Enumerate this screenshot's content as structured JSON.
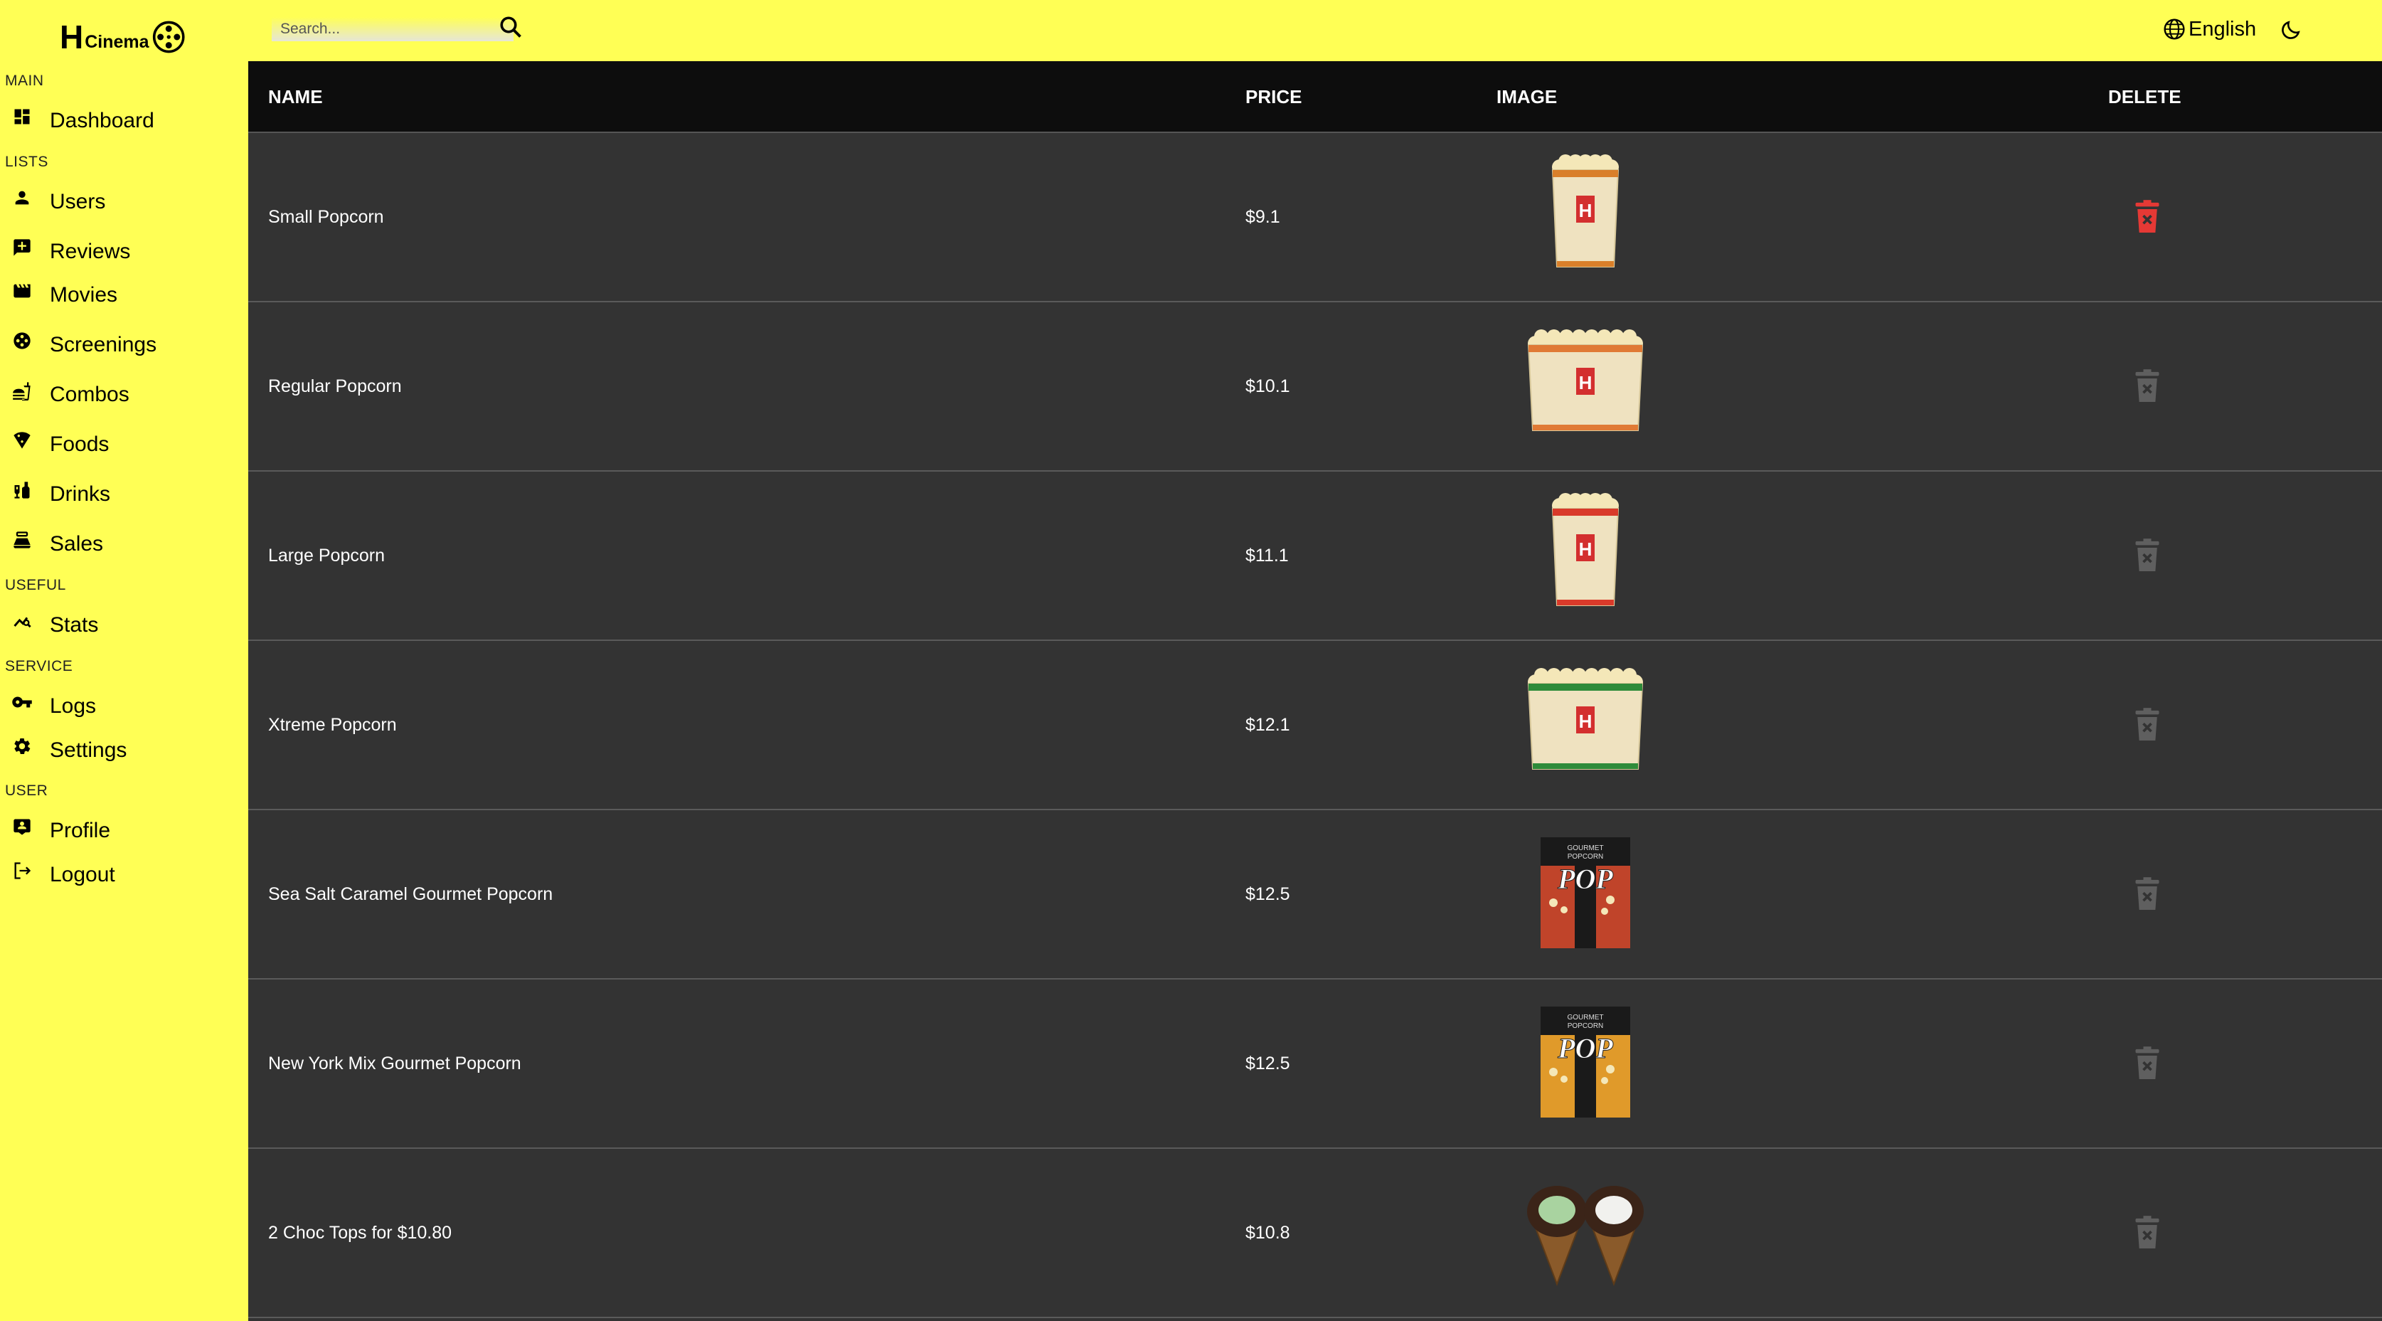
{
  "app": {
    "logo_mark": "H",
    "logo_text": "Cinema"
  },
  "sidebar": {
    "sections": {
      "main": "MAIN",
      "lists": "LISTS",
      "useful": "USEFUL",
      "service": "SERVICE",
      "user": "USER"
    },
    "items": {
      "dashboard": "Dashboard",
      "users": "Users",
      "reviews": "Reviews",
      "movies": "Movies",
      "screenings": "Screenings",
      "combos": "Combos",
      "foods": "Foods",
      "drinks": "Drinks",
      "sales": "Sales",
      "stats": "Stats",
      "logs": "Logs",
      "settings": "Settings",
      "profile": "Profile",
      "logout": "Logout"
    }
  },
  "topbar": {
    "search_placeholder": "Search...",
    "language": "English"
  },
  "table": {
    "headers": {
      "name": "NAME",
      "price": "PRICE",
      "image": "IMAGE",
      "delete": "DELETE"
    },
    "rows": [
      {
        "name": "Small Popcorn",
        "price": "$9.1",
        "image": "popcorn-small",
        "delete_active": true
      },
      {
        "name": "Regular Popcorn",
        "price": "$10.1",
        "image": "popcorn-regular",
        "delete_active": false
      },
      {
        "name": "Large Popcorn",
        "price": "$11.1",
        "image": "popcorn-large",
        "delete_active": false
      },
      {
        "name": "Xtreme Popcorn",
        "price": "$12.1",
        "image": "popcorn-xtreme",
        "delete_active": false
      },
      {
        "name": "Sea Salt Caramel Gourmet Popcorn",
        "price": "$12.5",
        "image": "gourmet-sea-salt",
        "delete_active": false
      },
      {
        "name": "New York Mix Gourmet Popcorn",
        "price": "$12.5",
        "image": "gourmet-new-york",
        "delete_active": false
      },
      {
        "name": "2 Choc Tops for $10.80",
        "price": "$10.8",
        "image": "choc-tops",
        "delete_active": false
      }
    ]
  },
  "product_art": {
    "box_label": "H",
    "gourmet_line1": "GOURMET",
    "gourmet_line2": "POPCORN",
    "pop": "POP"
  },
  "colors": {
    "sidebar_bg": "#ffff55",
    "header_bg": "#0d0d0d",
    "row_bg": "#333333",
    "delete_active": "#e53935",
    "delete_inactive": "#5f5f5f"
  }
}
